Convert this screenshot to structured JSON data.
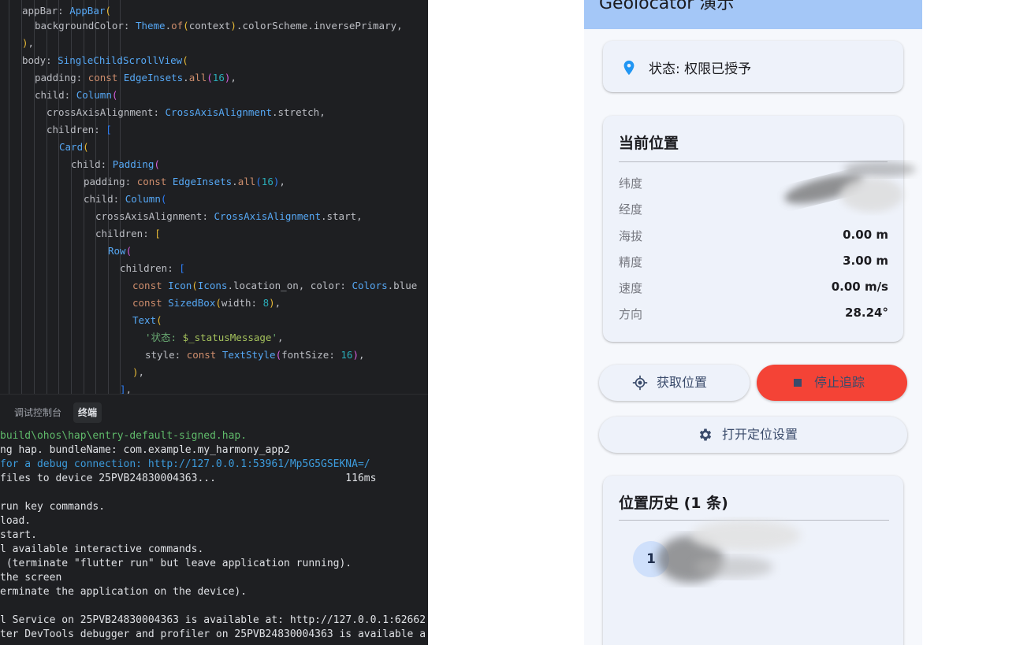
{
  "editor": {
    "lines": [
      [
        [
          "",
          "appBar: "
        ],
        [
          "fn",
          "AppBar"
        ],
        [
          "ylw",
          "("
        ]
      ],
      [
        [
          "",
          "backgroundColor: "
        ],
        [
          "fn",
          "Theme"
        ],
        [
          "",
          "."
        ],
        [
          "kw",
          "of"
        ],
        [
          "ylw",
          "("
        ],
        [
          "",
          "context"
        ],
        [
          "ylw",
          ")"
        ],
        [
          "",
          ".colorScheme.inversePrimary,"
        ]
      ],
      [
        [
          "ylw",
          ")"
        ],
        [
          "",
          ","
        ]
      ],
      [
        [
          "",
          "body: "
        ],
        [
          "fn",
          "SingleChildScrollView"
        ],
        [
          "ylw",
          "("
        ]
      ],
      [
        [
          "",
          "padding: "
        ],
        [
          "kw",
          "const "
        ],
        [
          "fn",
          "EdgeInsets"
        ],
        [
          "",
          "."
        ],
        [
          "kw",
          "all"
        ],
        [
          "pnk",
          "("
        ],
        [
          "num",
          "16"
        ],
        [
          "pnk",
          ")"
        ],
        [
          "",
          ","
        ]
      ],
      [
        [
          "",
          "child: "
        ],
        [
          "fn",
          "Column"
        ],
        [
          "pnk",
          "("
        ]
      ],
      [
        [
          "",
          "crossAxisAlignment: "
        ],
        [
          "fn",
          "CrossAxisAlignment"
        ],
        [
          "",
          ".stretch,"
        ]
      ],
      [
        [
          "",
          "children: "
        ],
        [
          "blu",
          "["
        ]
      ],
      [
        [
          "fn",
          "Card"
        ],
        [
          "ylw",
          "("
        ]
      ],
      [
        [
          "",
          "child: "
        ],
        [
          "fn",
          "Padding"
        ],
        [
          "pnk",
          "("
        ]
      ],
      [
        [
          "",
          "padding: "
        ],
        [
          "kw",
          "const "
        ],
        [
          "fn",
          "EdgeInsets"
        ],
        [
          "",
          "."
        ],
        [
          "kw",
          "all"
        ],
        [
          "blu",
          "("
        ],
        [
          "num",
          "16"
        ],
        [
          "blu",
          ")"
        ],
        [
          "",
          ","
        ]
      ],
      [
        [
          "",
          "child: "
        ],
        [
          "fn",
          "Column"
        ],
        [
          "blu",
          "("
        ]
      ],
      [
        [
          "",
          "crossAxisAlignment: "
        ],
        [
          "fn",
          "CrossAxisAlignment"
        ],
        [
          "",
          ".start,"
        ]
      ],
      [
        [
          "",
          "children: "
        ],
        [
          "ylw",
          "["
        ]
      ],
      [
        [
          "fn",
          "Row"
        ],
        [
          "pnk",
          "("
        ]
      ],
      [
        [
          "",
          "children: "
        ],
        [
          "blu",
          "["
        ]
      ],
      [
        [
          "kw",
          "const "
        ],
        [
          "fn",
          "Icon"
        ],
        [
          "ylw",
          "("
        ],
        [
          "fn",
          "Icons"
        ],
        [
          "",
          ".location_on, color: "
        ],
        [
          "fn",
          "Colors"
        ],
        [
          "",
          ".blue"
        ]
      ],
      [
        [
          "kw",
          "const "
        ],
        [
          "fn",
          "SizedBox"
        ],
        [
          "ylw",
          "("
        ],
        [
          "",
          "width: "
        ],
        [
          "num",
          "8"
        ],
        [
          "ylw",
          ")"
        ],
        [
          "",
          ","
        ]
      ],
      [
        [
          "fn",
          "Text"
        ],
        [
          "ylw",
          "("
        ]
      ],
      [
        [
          "str",
          "'状态: "
        ],
        [
          "grn",
          "$_statusMessage"
        ],
        [
          "str",
          "'"
        ],
        [
          "",
          ","
        ]
      ],
      [
        [
          "",
          "style: "
        ],
        [
          "kw",
          "const "
        ],
        [
          "fn",
          "TextStyle"
        ],
        [
          "pnk",
          "("
        ],
        [
          "",
          "fontSize: "
        ],
        [
          "num",
          "16"
        ],
        [
          "pnk",
          ")"
        ],
        [
          "",
          ","
        ]
      ],
      [
        [
          "ylw",
          ")"
        ],
        [
          "",
          ","
        ]
      ],
      [
        [
          "blu",
          "]"
        ],
        [
          "",
          ","
        ]
      ]
    ]
  },
  "terminal": {
    "tabs": [
      "调试控制台",
      "终端"
    ],
    "active_tab": "终端",
    "lines": [
      {
        "text": "build\\ohos\\hap\\entry-default-signed.hap.",
        "color": "green"
      },
      {
        "text": "ng hap. bundleName: com.example.my_harmony_app2",
        "color": ""
      },
      {
        "text": "for a debug connection: http://127.0.0.1:53961/Mp5G5GSEKNA=/",
        "color": "blue"
      },
      {
        "text": "files to device 25PVB24830004363...                     116ms",
        "color": ""
      },
      {
        "text": "",
        "color": ""
      },
      {
        "text": "run key commands.",
        "color": ""
      },
      {
        "text": "load.",
        "color": ""
      },
      {
        "text": "start.",
        "color": ""
      },
      {
        "text": "l available interactive commands.",
        "color": ""
      },
      {
        "text": " (terminate \"flutter run\" but leave application running).",
        "color": ""
      },
      {
        "text": "the screen",
        "color": ""
      },
      {
        "text": "erminate the application on the device).",
        "color": ""
      },
      {
        "text": "",
        "color": ""
      },
      {
        "text": "l Service on 25PVB24830004363 is available at: http://127.0.0.1:62662",
        "color": ""
      },
      {
        "text": "ter DevTools debugger and profiler on 25PVB24830004363 is available a",
        "color": ""
      }
    ]
  },
  "app": {
    "title": "Geolocator 演示",
    "status_text": "状态: 权限已授予",
    "location_card": {
      "title": "当前位置",
      "rows": [
        {
          "label": "纬度",
          "value": ""
        },
        {
          "label": "经度",
          "value": ""
        },
        {
          "label": "海拔",
          "value": "0.00 m"
        },
        {
          "label": "精度",
          "value": "3.00 m"
        },
        {
          "label": "速度",
          "value": "0.00 m/s"
        },
        {
          "label": "方向",
          "value": "28.24°"
        }
      ]
    },
    "buttons": {
      "get_position": "获取位置",
      "stop_tracking": "停止追踪",
      "open_settings": "打开定位设置"
    },
    "history_card": {
      "title": "位置历史 (1 条)",
      "first_index": "1"
    }
  },
  "colors": {
    "app_bar": "#a4c7f7",
    "stop_button": "#f44336",
    "location_pin": "#2196f3",
    "editor_bg": "#1e1f22"
  }
}
